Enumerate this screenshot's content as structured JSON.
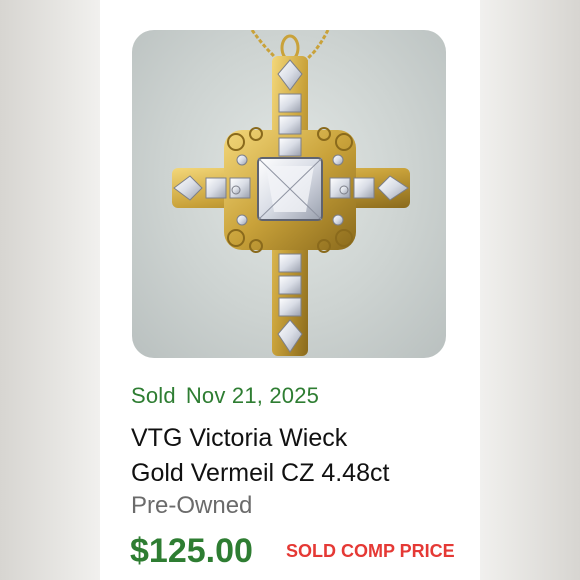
{
  "listing": {
    "image_description": "gold vermeil cross pendant with cubic zirconia stones on chain",
    "sold_label": "Sold",
    "sold_date": "Nov 21, 2025",
    "title_line1": "VTG Victoria Wieck",
    "title_line2": "Gold Vermeil CZ 4.48ct",
    "condition": "Pre-Owned",
    "price": "$125.00",
    "overlay_note": "SOLD COMP PRICE"
  },
  "colors": {
    "sold_green": "#2e7d32",
    "price_green": "#2e7d32",
    "note_red": "#e53935",
    "title_text": "#111111",
    "condition_gray": "#6b6b6b",
    "gold": "#c9a23a"
  }
}
